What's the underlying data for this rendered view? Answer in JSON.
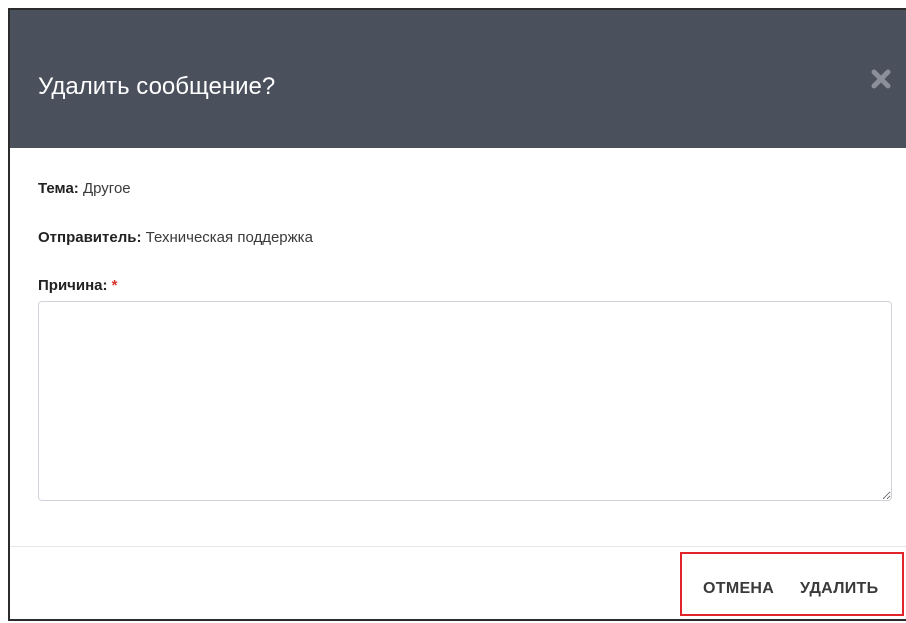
{
  "dialog": {
    "title": "Удалить сообщение?",
    "close_icon": "close-icon"
  },
  "fields": {
    "topic_label": "Тема:",
    "topic_value": "Другое",
    "sender_label": "Отправитель:",
    "sender_value": "Техническая поддержка",
    "reason_label": "Причина:",
    "reason_required_mark": "*",
    "reason_value": ""
  },
  "footer": {
    "cancel_label": "ОТМЕНА",
    "delete_label": "УДАЛИТЬ"
  },
  "colors": {
    "header_bg": "#4b505d",
    "required": "#d9342b",
    "highlight": "#e0242a"
  }
}
